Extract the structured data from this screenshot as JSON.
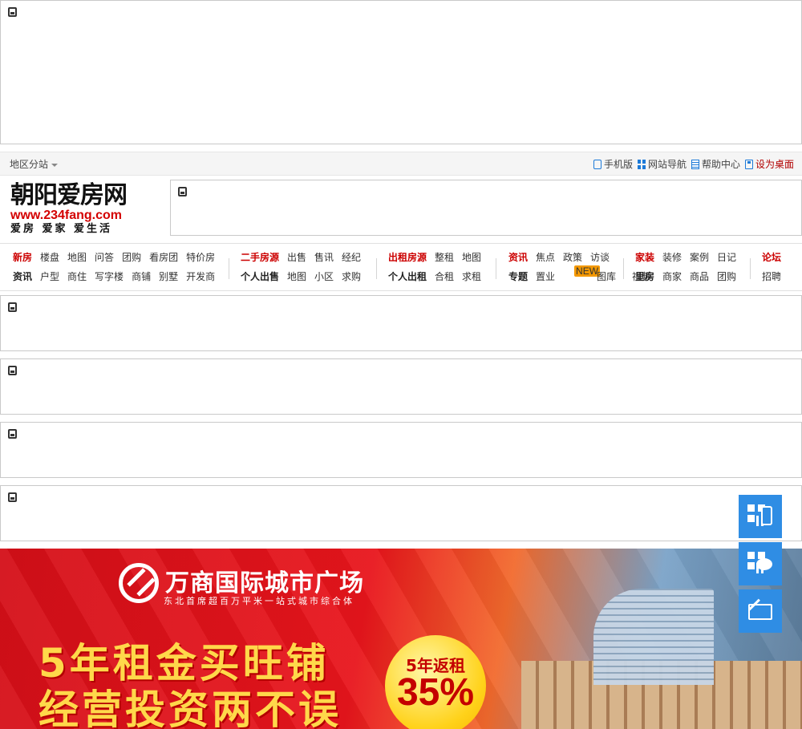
{
  "topbar": {
    "region_label": "地区分站",
    "links": [
      {
        "label": "手机版",
        "icon": "mobile-icon"
      },
      {
        "label": "网站导航",
        "icon": "grid-icon"
      },
      {
        "label": "帮助中心",
        "icon": "document-icon"
      },
      {
        "label": "设为桌面",
        "icon": "save-icon"
      }
    ]
  },
  "logo": {
    "name": "朝阳爱房网",
    "url": "www.234fang.com",
    "slogan": "爱房 爱家 爱生活"
  },
  "nav": {
    "g1": {
      "r1": [
        "新房",
        "楼盘",
        "地图",
        "问答",
        "团购",
        "看房团",
        "特价房"
      ],
      "r2": [
        "资讯",
        "户型",
        "商住",
        "写字楼",
        "商铺",
        "别墅",
        "开发商"
      ]
    },
    "g2": {
      "r1": [
        "二手房源",
        "出售",
        "售讯",
        "经纪"
      ],
      "r2": [
        "个人出售",
        "地图",
        "小区",
        "求购"
      ]
    },
    "g3": {
      "r1": [
        "出租房源",
        "整租",
        "地图"
      ],
      "r2": [
        "个人出租",
        "合租",
        "求租"
      ]
    },
    "g4": {
      "r1": [
        "资讯",
        "焦点",
        "政策",
        "访谈"
      ],
      "r2": [
        "专题",
        "置业",
        "图库",
        "视频"
      ],
      "badge": "NEW"
    },
    "g5": {
      "r1": [
        "家装",
        "装修",
        "案例",
        "日记"
      ],
      "r2": [
        "里房",
        "商家",
        "商品",
        "团购"
      ]
    },
    "g6": {
      "r1": [
        "论坛"
      ],
      "r2": [
        "招聘"
      ]
    }
  },
  "banner": {
    "title": "万商国际城市广场",
    "subtitle": "东北首席超百万平米一站式城市综合体",
    "line1": "5年租金买旺铺",
    "line2": "经营投资两不误",
    "promo_top": "5年返租",
    "promo_value": "35%"
  },
  "colors": {
    "accent_red": "#c00000",
    "side_blue": "#2f8de4"
  }
}
